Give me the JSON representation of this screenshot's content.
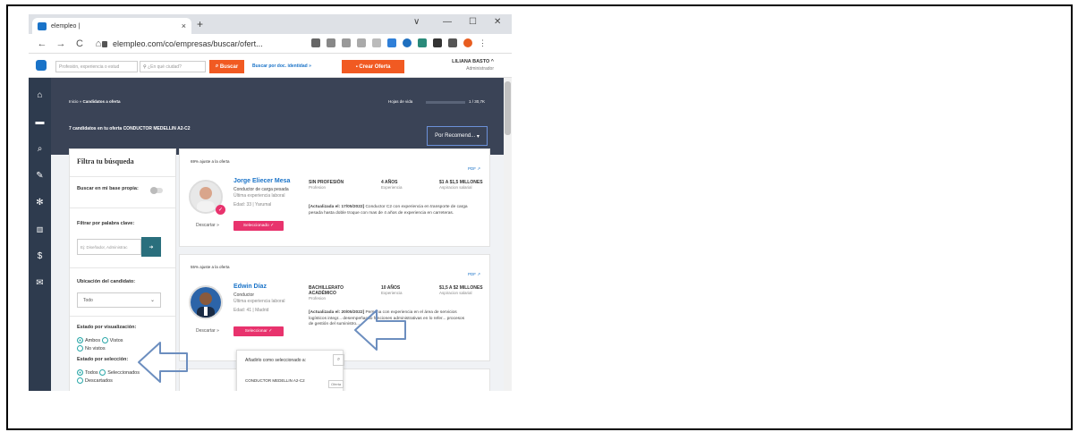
{
  "browser": {
    "tab_title": "elempleo |",
    "tab_close": "×",
    "new_tab": "+",
    "url": "elempleo.com/co/empresas/buscar/ofert...",
    "window_minimize": "—",
    "window_maximize": "☐",
    "window_close": "✕",
    "window_menu": "∨"
  },
  "site_header": {
    "search_placeholder": "Profesión, experiencia o estud",
    "city_placeholder": "¿En qué ciudad?",
    "search_button": "Buscar",
    "doc_search": "Buscar por doc. identidad »",
    "create_button": "Crear Oferta",
    "user_name": "LILIANA BASTO",
    "user_role": "Administrador"
  },
  "breadcrumb": {
    "home": "Inicio",
    "current": "Candidatos a oferta"
  },
  "hojas": {
    "label": "Hojas de vida",
    "value": "1 / 30,7K"
  },
  "summary": "7 candidatos en tu oferta CONDUCTOR MEDELLIN A2-C2",
  "sort_label": "Por Recomend...",
  "filter": {
    "title": "Filtra tu búsqueda",
    "own_base_label": "Buscar en mi base propia:",
    "keyword_label": "Filtrar por palabra clave:",
    "keyword_placeholder": "Ej: Diseñador, Administrac",
    "location_label": "Ubicación del candidato:",
    "location_value": "Todo",
    "view_state_label": "Estado por visualización:",
    "view_options": [
      "Ambos",
      "Vistos",
      "No vistos"
    ],
    "selection_state_label": "Estado por selección:",
    "selection_options": [
      "Todos",
      "Seleccionados",
      "Descartados"
    ]
  },
  "candidates": [
    {
      "match": "69% ajuste a la oferta",
      "pdf": "PDF",
      "name": "Jorge Eliecer Mesa",
      "title": "Conductor de carga pesada",
      "last_exp": "Última experiencia laboral",
      "age_city": "Edad: 33 | Yarumal",
      "education": "SIN PROFESIÓN",
      "education_sub": "Profesion",
      "experience": "4 AÑOS",
      "experience_sub": "Experiencia",
      "salary": "$1 A $1,5 MILLONES",
      "salary_sub": "Aspiracion salarial",
      "desc_date": "[Actualizada el: 17/05/2022]",
      "desc": "Conductor C2 con experiencia en transporte de carga pesada hasta doble troque con mas de 4 años de experiencia en carreteras.",
      "discard": "Descartar",
      "selected": "Seleccionado"
    },
    {
      "match": "55% ajuste a la oferta",
      "pdf": "PDF",
      "name": "Edwin Díaz",
      "title": "Conductor",
      "last_exp": "Última experiencia laboral",
      "age_city": "Edad: 41 | Madrid",
      "education": "BACHILLERATO ACADÉMICO",
      "education_sub": "Profesion",
      "experience": "10 AÑOS",
      "experience_sub": "Experiencia",
      "salary": "$1,5 A $2 MILLONES",
      "salary_sub": "Aspiracion salarial",
      "desc_date": "[Actualizada el: 20/05/2022]",
      "desc": "Persona con experiencia en el área de servicios logísticos integr... desempeñando funciones administrativas en lo refer... procesos de gestión del suministro...",
      "discard": "Descartar",
      "selected": "Seleccionar"
    }
  ],
  "popup": {
    "title": "Añadirlo como seleccionado a:",
    "item": "CONDUCTOR MEDELLIN A2-C2",
    "tag": "Oferta"
  },
  "colors": {
    "brand_orange": "#f15a22",
    "nav_dark": "#2e3b4e",
    "select_pink": "#e8336d",
    "link_blue": "#1a73c8",
    "arrow_blue": "#6c8ebf"
  }
}
